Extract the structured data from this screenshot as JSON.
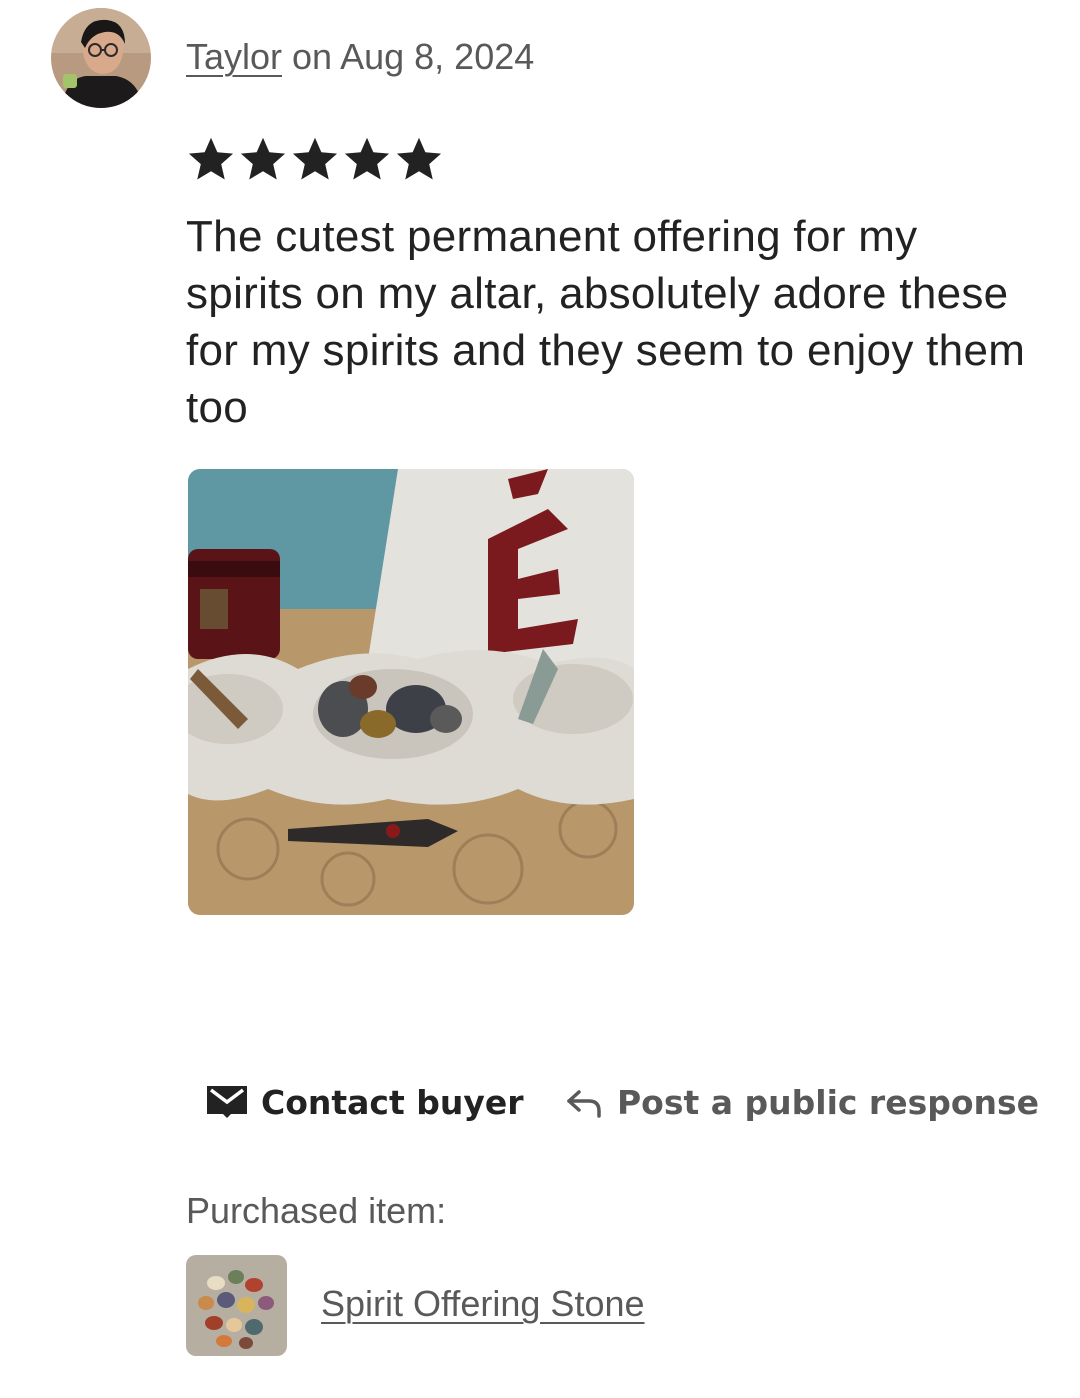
{
  "review": {
    "reviewer_name": "Taylor",
    "date_prefix": " on ",
    "date": "Aug 8, 2024",
    "rating": 5,
    "max_rating": 5,
    "text": "The cutest permanent offering for my spirits on my altar, absolutely adore these for my spirits and they seem to enjoy them too"
  },
  "actions": {
    "contact_label": "Contact buyer",
    "respond_label": "Post a public response"
  },
  "purchased": {
    "label": "Purchased item:",
    "item_name": "Spirit Offering Stone"
  },
  "colors": {
    "text_primary": "#222222",
    "text_secondary": "#595959",
    "background": "#ffffff"
  },
  "icons": {
    "contact": "envelope-icon",
    "respond": "reply-arrow-icon",
    "rating": "star-icon"
  }
}
